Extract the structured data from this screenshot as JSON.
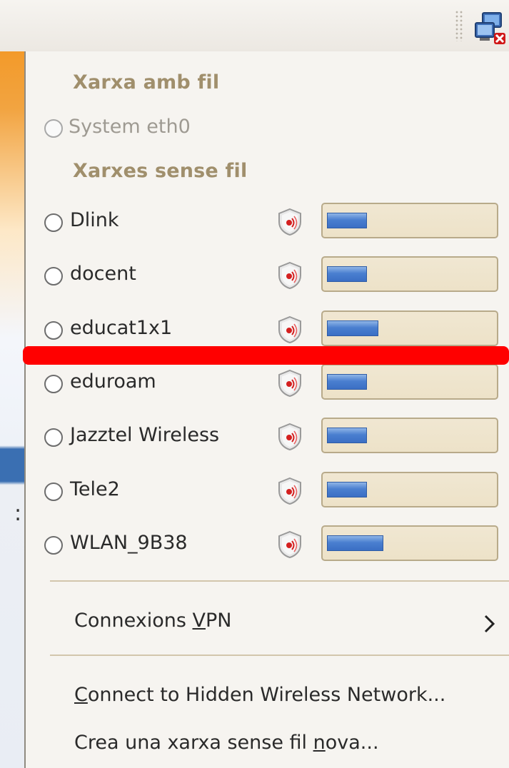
{
  "menu": {
    "wired_header": "Xarxa amb fil",
    "wired_items": [
      {
        "label": "System eth0",
        "enabled": false
      }
    ],
    "wireless_header": "Xarxes sense fil",
    "wireless_items": [
      {
        "label": "Dlink",
        "signal_percent": 24,
        "secured": true
      },
      {
        "label": "docent",
        "signal_percent": 24,
        "secured": true
      },
      {
        "label": "educat1x1",
        "signal_percent": 31,
        "secured": true
      },
      {
        "label": "eduroam",
        "signal_percent": 24,
        "secured": true
      },
      {
        "label": "Jazztel Wireless",
        "signal_percent": 24,
        "secured": true
      },
      {
        "label": "Tele2",
        "signal_percent": 24,
        "secured": true
      },
      {
        "label": "WLAN_9B38",
        "signal_percent": 34,
        "secured": true
      }
    ],
    "vpn": {
      "label_pre": "Connexions ",
      "label_mnemonic": "V",
      "label_post": "PN"
    },
    "hidden": {
      "label_mnemonic": "C",
      "label_post": "onnect to Hidden Wireless Network..."
    },
    "create": {
      "label_pre": "Crea una xarxa sense fil ",
      "label_mnemonic": "n",
      "label_post": "ova..."
    }
  },
  "colors": {
    "header_text": "#a08f6c",
    "signal_fill": "#4a7fd0",
    "annotation_line": "#ff0000"
  },
  "icons": {
    "tray": "network-disconnected-icon",
    "security": "shield-icon",
    "submenu": "chevron-right-icon"
  }
}
